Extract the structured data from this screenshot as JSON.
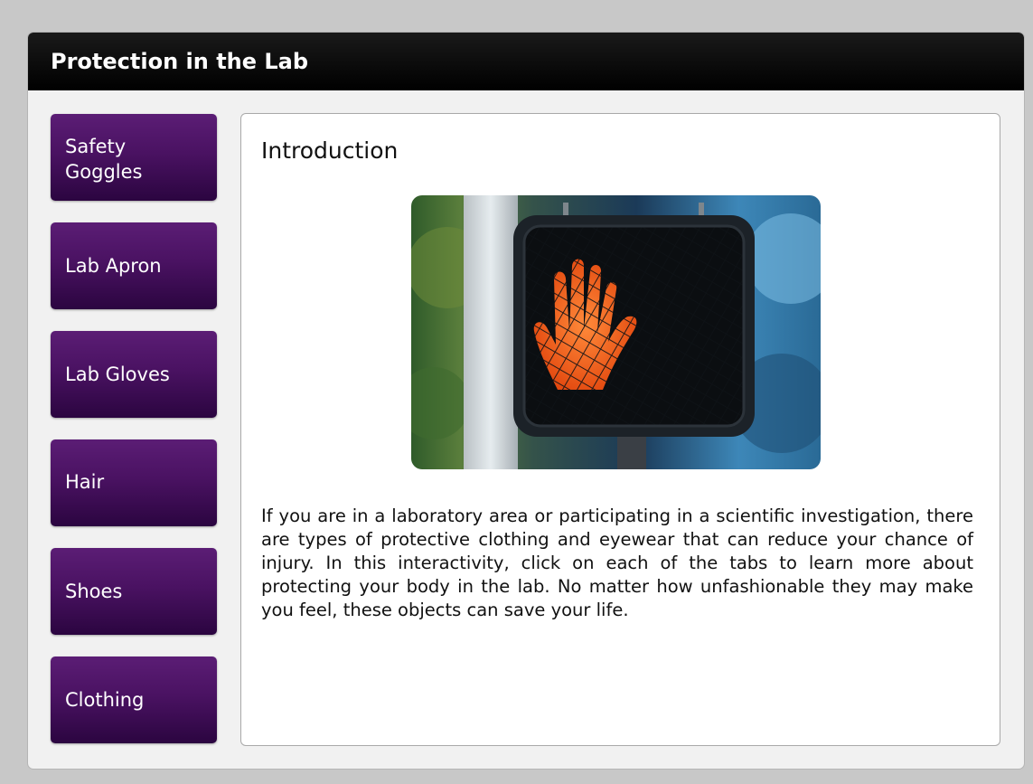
{
  "window": {
    "title": "Protection in the Lab"
  },
  "tabs": [
    {
      "label": "Safety Goggles"
    },
    {
      "label": "Lab Apron"
    },
    {
      "label": "Lab Gloves"
    },
    {
      "label": "Hair"
    },
    {
      "label": "Shoes"
    },
    {
      "label": "Clothing"
    }
  ],
  "content": {
    "heading": "Introduction",
    "image": {
      "icon": "crosswalk-stop-hand-signal"
    },
    "body": "If you are in a laboratory area or participating in a scientific investigation, there are types of protective clothing and eyewear that can reduce your chance of injury. In this interactivity, click on each of the tabs to learn more about protecting your body in the lab. No matter how unfashionable they may make you feel, these objects can save your life."
  },
  "colors": {
    "tab_accent": "#4a1262",
    "title_bar": "#000000",
    "signal_hand": "#ff5a14"
  }
}
